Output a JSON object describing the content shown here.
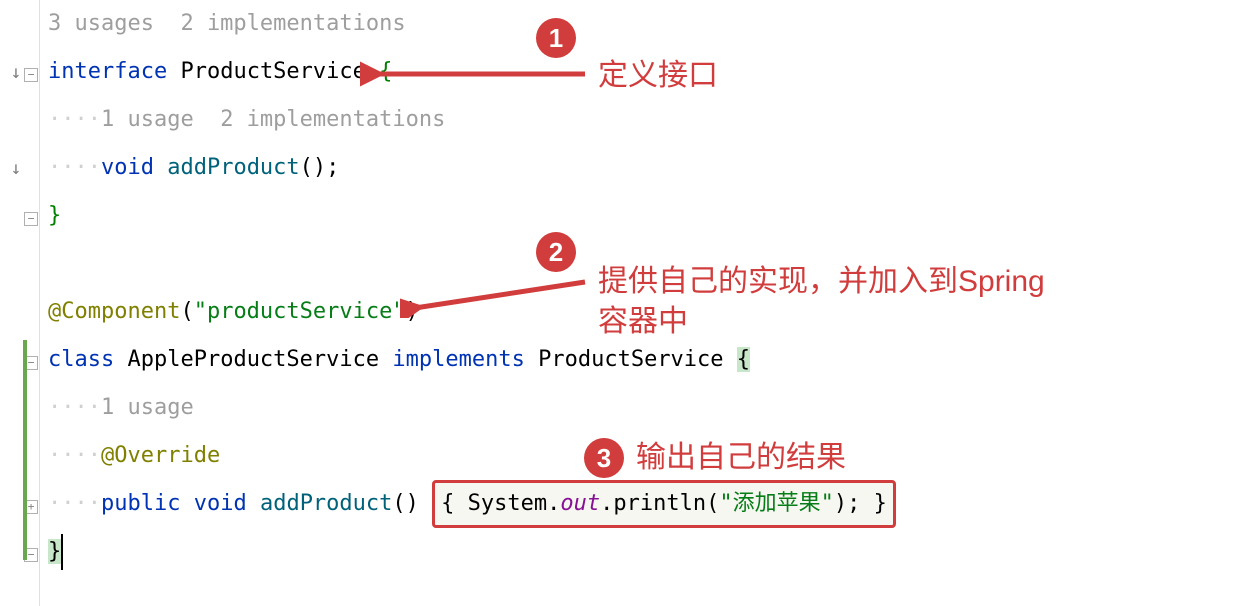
{
  "hints": {
    "interface_usages": "3 usages  2 implementations",
    "method_usages": "1 usage  2 implementations",
    "class_usage": "1 usage"
  },
  "code": {
    "keyword_interface": "interface",
    "type_product_service": "ProductService",
    "keyword_void": "void",
    "method_addproduct": "addProduct",
    "annotation_component": "@Component",
    "string_productservice": "\"productService\"",
    "keyword_class": "class",
    "type_apple": "AppleProductService",
    "keyword_implements": "implements",
    "annotation_override": "@Override",
    "keyword_public": "public",
    "inline_system": "System",
    "inline_out": "out",
    "inline_println": "println",
    "inline_string": "\"添加苹果\""
  },
  "annotations": {
    "badge1": "1",
    "text1": "定义接口",
    "badge2": "2",
    "text2": "提供自己的实现，并加入到Spring容器中",
    "badge3": "3",
    "text3": "输出自己的结果"
  }
}
